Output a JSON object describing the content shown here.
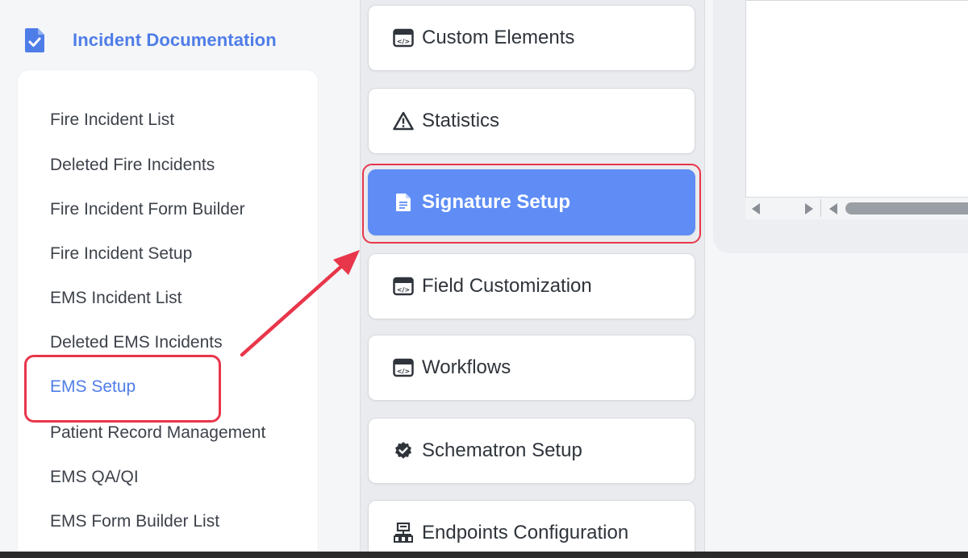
{
  "sidebar": {
    "title": "Incident Documentation",
    "items": [
      {
        "label": "Fire Incident List"
      },
      {
        "label": "Deleted Fire Incidents"
      },
      {
        "label": "Fire Incident Form Builder"
      },
      {
        "label": "Fire Incident Setup"
      },
      {
        "label": "EMS Incident List"
      },
      {
        "label": "Deleted EMS Incidents"
      },
      {
        "label": "EMS Setup"
      },
      {
        "label": "Patient Record Management"
      },
      {
        "label": "EMS QA/QI"
      },
      {
        "label": "EMS Form Builder List"
      }
    ],
    "active_item": "EMS Setup"
  },
  "menu": {
    "buttons": [
      {
        "label": "Custom Elements",
        "icon": "custom-element-icon"
      },
      {
        "label": "Statistics",
        "icon": "warning-icon"
      },
      {
        "label": "Signature Setup",
        "icon": "document-icon"
      },
      {
        "label": "Field Customization",
        "icon": "custom-element-icon"
      },
      {
        "label": "Workflows",
        "icon": "custom-element-icon"
      },
      {
        "label": "Schematron Setup",
        "icon": "badge-check-icon"
      },
      {
        "label": "Endpoints Configuration",
        "icon": "network-icon"
      }
    ],
    "selected": "Signature Setup"
  },
  "colors": {
    "accent": "#4f7de8",
    "selected_button": "#5f8df5",
    "annotation": "#e8364a"
  }
}
